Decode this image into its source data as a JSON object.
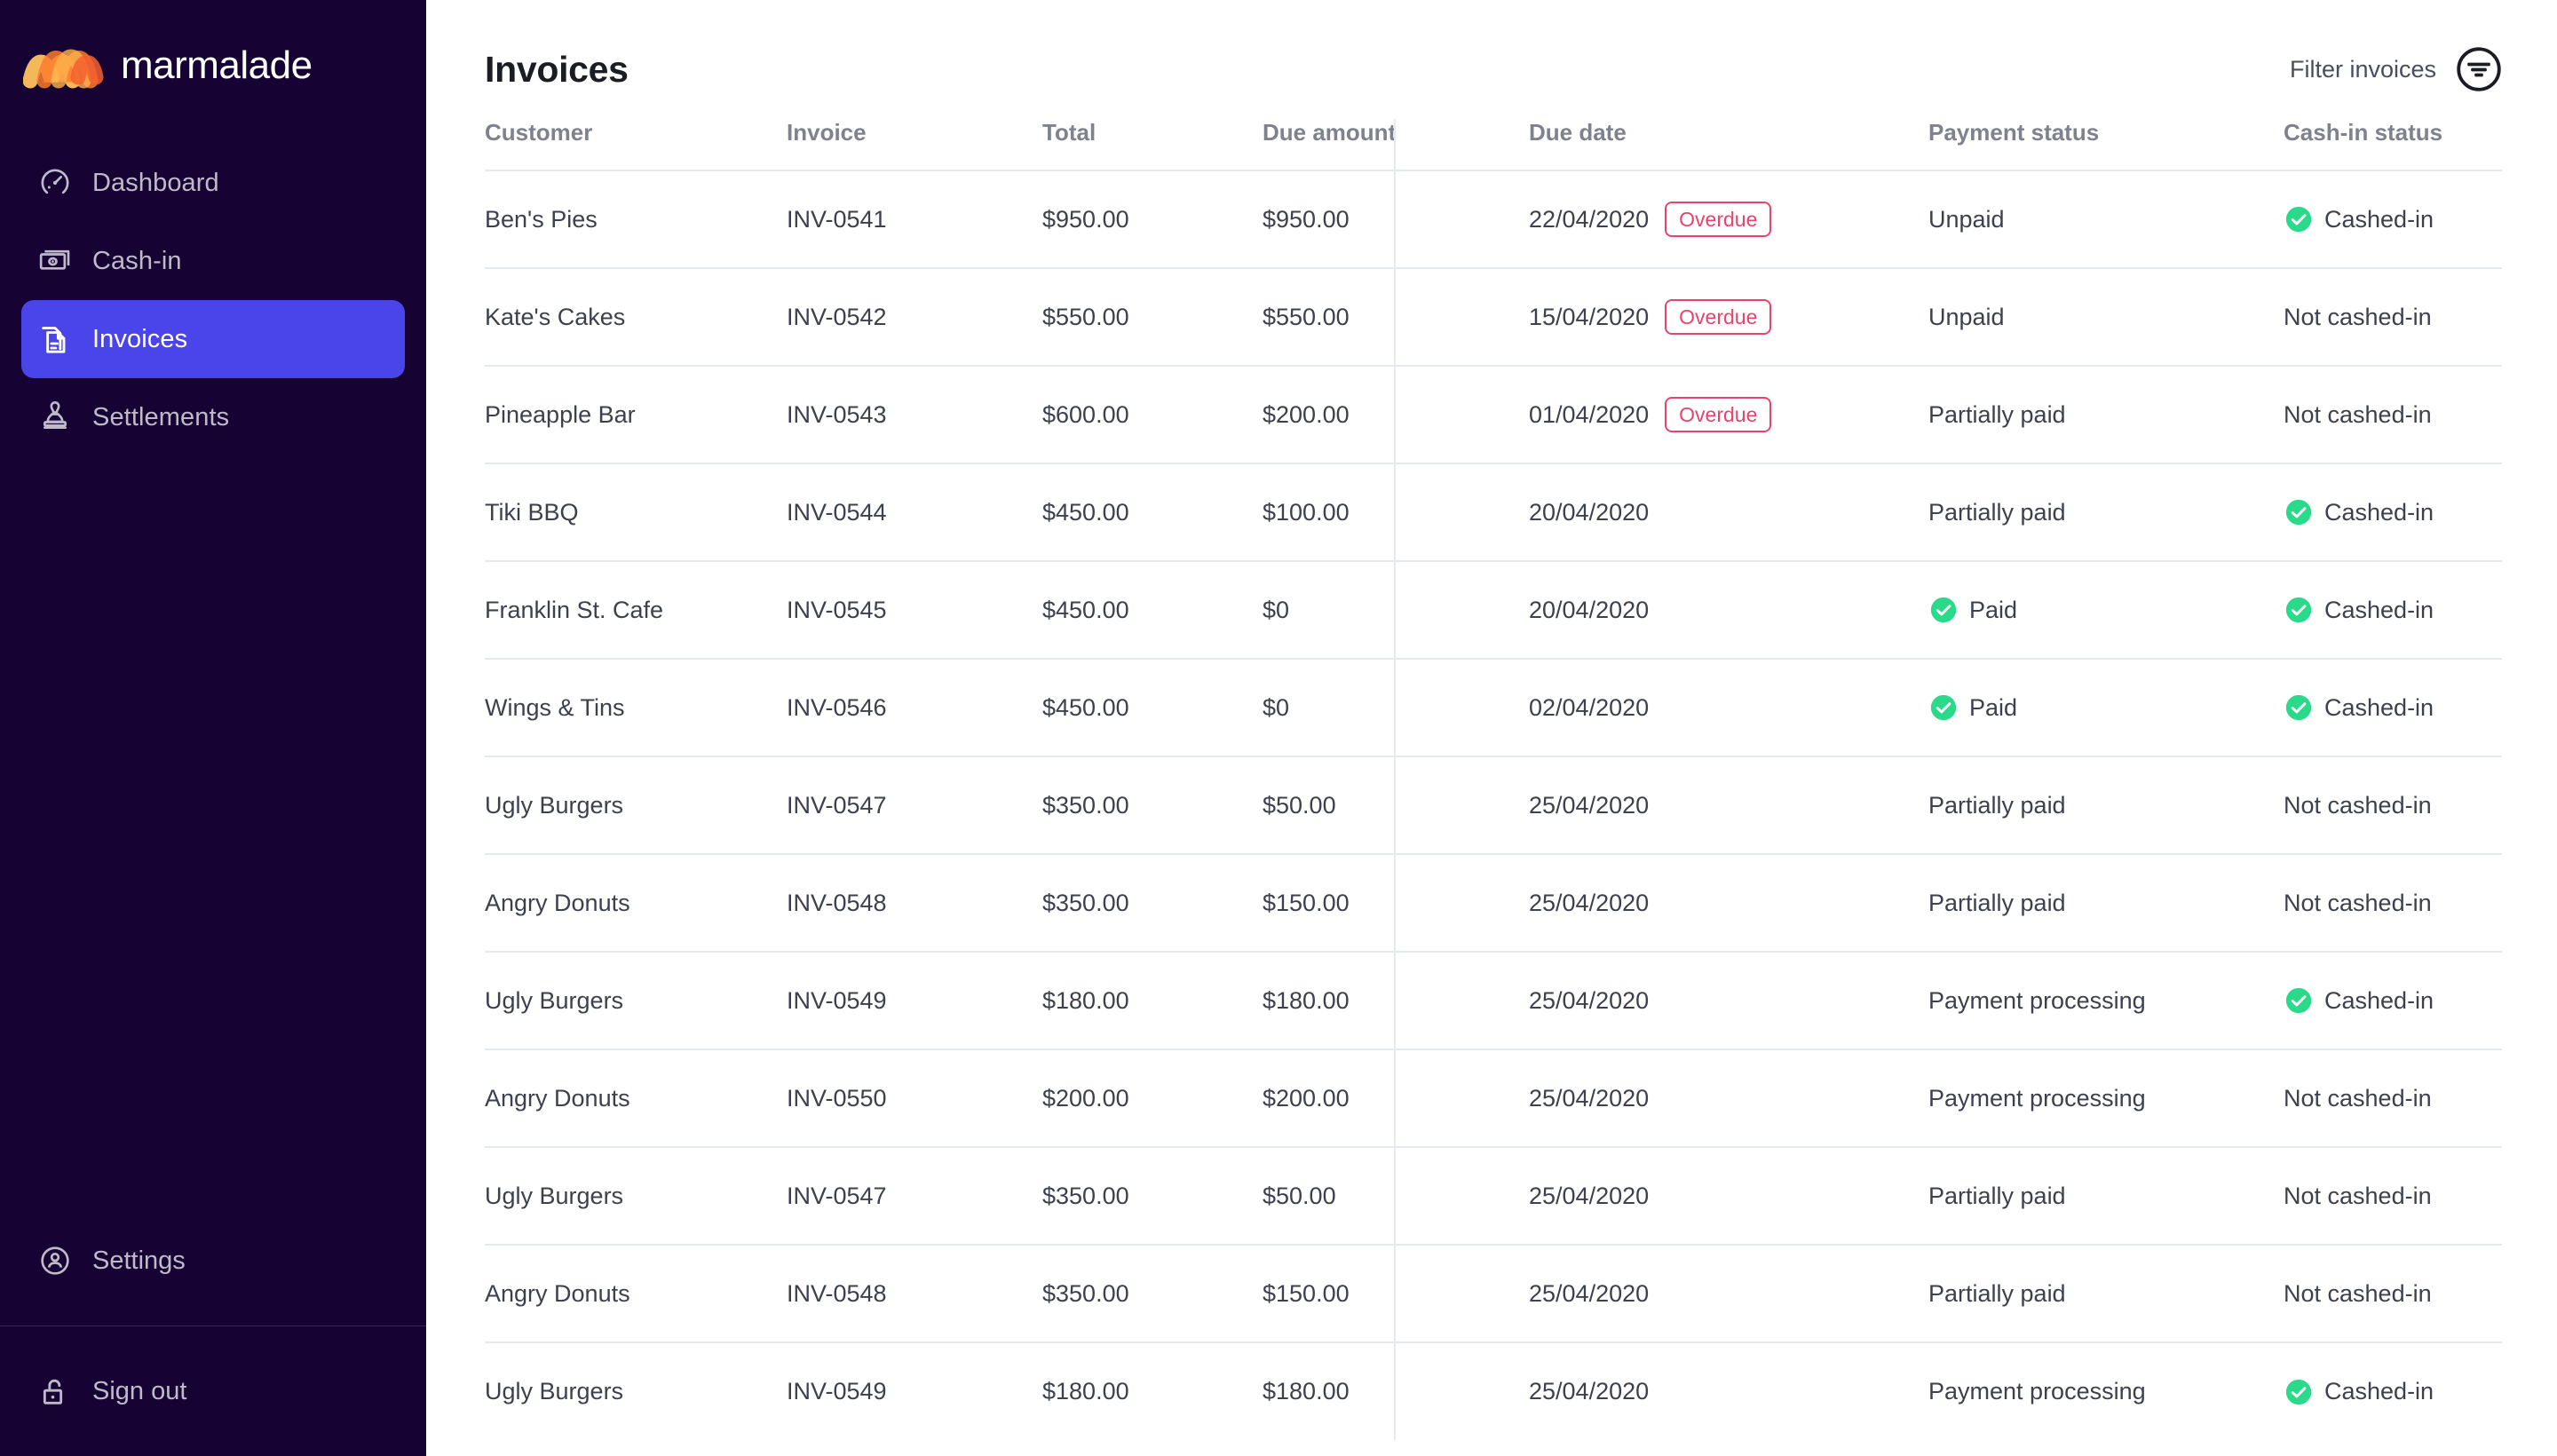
{
  "brand": {
    "name": "marmalade",
    "logo_icon": "marmalade-wave-logo"
  },
  "sidebar": {
    "nav": [
      {
        "label": "Dashboard",
        "icon": "speedometer-icon",
        "active": false
      },
      {
        "label": "Cash-in",
        "icon": "banknotes-icon",
        "active": false
      },
      {
        "label": "Invoices",
        "icon": "documents-icon",
        "active": true
      },
      {
        "label": "Settlements",
        "icon": "stamp-icon",
        "active": false
      }
    ],
    "bottom": [
      {
        "label": "Settings",
        "icon": "user-circle-icon"
      },
      {
        "label": "Sign out",
        "icon": "unlocked-padlock-icon"
      }
    ],
    "active_color": "#4a44eb",
    "bg_color": "#160334"
  },
  "header": {
    "title": "Invoices",
    "filter_label": "Filter invoices",
    "filter_icon": "filter-circle-icon"
  },
  "table": {
    "columns": [
      "Customer",
      "Invoice",
      "Total",
      "Due amount",
      "Due date",
      "Payment status",
      "Cash-in status"
    ],
    "overdue_badge_label": "Overdue",
    "overdue_color": "#e8436b",
    "cashed_in_color": "#2bd98a",
    "rows": [
      {
        "customer": "Ben's Pies",
        "invoice": "INV-0541",
        "total": "$950.00",
        "due_amount": "$950.00",
        "due_date": "22/04/2020",
        "overdue": true,
        "payment_status": "Unpaid",
        "payment_paid": false,
        "cash_status": "Cashed-in",
        "cashed_in": true
      },
      {
        "customer": "Kate's Cakes",
        "invoice": "INV-0542",
        "total": "$550.00",
        "due_amount": "$550.00",
        "due_date": "15/04/2020",
        "overdue": true,
        "payment_status": "Unpaid",
        "payment_paid": false,
        "cash_status": "Not cashed-in",
        "cashed_in": false
      },
      {
        "customer": "Pineapple Bar",
        "invoice": "INV-0543",
        "total": "$600.00",
        "due_amount": "$200.00",
        "due_date": "01/04/2020",
        "overdue": true,
        "payment_status": "Partially paid",
        "payment_paid": false,
        "cash_status": "Not cashed-in",
        "cashed_in": false
      },
      {
        "customer": "Tiki BBQ",
        "invoice": "INV-0544",
        "total": "$450.00",
        "due_amount": "$100.00",
        "due_date": "20/04/2020",
        "overdue": false,
        "payment_status": "Partially paid",
        "payment_paid": false,
        "cash_status": "Cashed-in",
        "cashed_in": true
      },
      {
        "customer": "Franklin St. Cafe",
        "invoice": "INV-0545",
        "total": "$450.00",
        "due_amount": "$0",
        "due_date": "20/04/2020",
        "overdue": false,
        "payment_status": "Paid",
        "payment_paid": true,
        "cash_status": "Cashed-in",
        "cashed_in": true
      },
      {
        "customer": "Wings & Tins",
        "invoice": "INV-0546",
        "total": "$450.00",
        "due_amount": "$0",
        "due_date": "02/04/2020",
        "overdue": false,
        "payment_status": "Paid",
        "payment_paid": true,
        "cash_status": "Cashed-in",
        "cashed_in": true
      },
      {
        "customer": "Ugly Burgers",
        "invoice": "INV-0547",
        "total": "$350.00",
        "due_amount": "$50.00",
        "due_date": "25/04/2020",
        "overdue": false,
        "payment_status": "Partially paid",
        "payment_paid": false,
        "cash_status": "Not cashed-in",
        "cashed_in": false
      },
      {
        "customer": "Angry Donuts",
        "invoice": "INV-0548",
        "total": "$350.00",
        "due_amount": "$150.00",
        "due_date": "25/04/2020",
        "overdue": false,
        "payment_status": "Partially paid",
        "payment_paid": false,
        "cash_status": "Not cashed-in",
        "cashed_in": false
      },
      {
        "customer": "Ugly Burgers",
        "invoice": "INV-0549",
        "total": "$180.00",
        "due_amount": "$180.00",
        "due_date": "25/04/2020",
        "overdue": false,
        "payment_status": "Payment processing",
        "payment_paid": false,
        "cash_status": "Cashed-in",
        "cashed_in": true
      },
      {
        "customer": "Angry Donuts",
        "invoice": "INV-0550",
        "total": "$200.00",
        "due_amount": "$200.00",
        "due_date": "25/04/2020",
        "overdue": false,
        "payment_status": "Payment processing",
        "payment_paid": false,
        "cash_status": "Not cashed-in",
        "cashed_in": false
      },
      {
        "customer": "Ugly Burgers",
        "invoice": "INV-0547",
        "total": "$350.00",
        "due_amount": "$50.00",
        "due_date": "25/04/2020",
        "overdue": false,
        "payment_status": "Partially paid",
        "payment_paid": false,
        "cash_status": "Not cashed-in",
        "cashed_in": false
      },
      {
        "customer": "Angry Donuts",
        "invoice": "INV-0548",
        "total": "$350.00",
        "due_amount": "$150.00",
        "due_date": "25/04/2020",
        "overdue": false,
        "payment_status": "Partially paid",
        "payment_paid": false,
        "cash_status": "Not cashed-in",
        "cashed_in": false
      },
      {
        "customer": "Ugly Burgers",
        "invoice": "INV-0549",
        "total": "$180.00",
        "due_amount": "$180.00",
        "due_date": "25/04/2020",
        "overdue": false,
        "payment_status": "Payment processing",
        "payment_paid": false,
        "cash_status": "Cashed-in",
        "cashed_in": true
      }
    ]
  }
}
